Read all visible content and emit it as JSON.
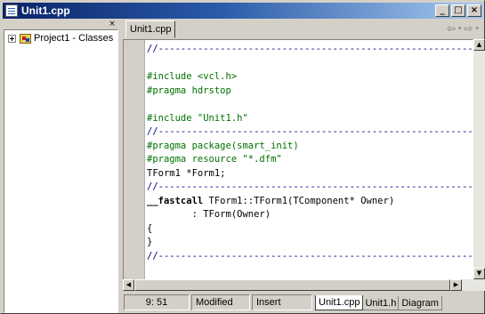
{
  "window": {
    "title": "Unit1.cpp"
  },
  "title_buttons": {
    "minimize": "_",
    "maximize": "□",
    "close": "×"
  },
  "class_explorer": {
    "close_glyph": "×",
    "tree": [
      {
        "label": "Project1 - Classes",
        "expander": "plus",
        "icon": "project-classes-icon"
      }
    ]
  },
  "editor": {
    "active_tab": "Unit1.cpp",
    "nav": {
      "back": "⇦",
      "forward": "⇨",
      "dropdown": "▾"
    },
    "code_lines": [
      {
        "text": "//---------------------------------------------------------------------------",
        "style": "navy"
      },
      {
        "text": "",
        "style": "black"
      },
      {
        "text": "#include <vcl.h>",
        "style": "green"
      },
      {
        "text": "#pragma hdrstop",
        "style": "green"
      },
      {
        "text": "",
        "style": "black"
      },
      {
        "text": "#include \"Unit1.h\"",
        "style": "green"
      },
      {
        "text": "//---------------------------------------------------------------------------",
        "style": "navy"
      },
      {
        "text": "#pragma package(smart_init)",
        "style": "green"
      },
      {
        "text": "#pragma resource \"*.dfm\"",
        "style": "green"
      },
      {
        "text": "TForm1 *Form1;",
        "style": "black"
      },
      {
        "text": "//---------------------------------------------------------------------------",
        "style": "navy"
      },
      {
        "text": "__fastcall TForm1::TForm1(TComponent* Owner)",
        "style": "fastcall"
      },
      {
        "text": "        : TForm(Owner)",
        "style": "black"
      },
      {
        "text": "{",
        "style": "black"
      },
      {
        "text": "}",
        "style": "black"
      },
      {
        "text": "//---------------------------------------------------------------------------",
        "style": "navy"
      }
    ]
  },
  "scrollbars": {
    "up": "▲",
    "down": "▼",
    "left": "◀",
    "right": "▶"
  },
  "status": {
    "position": "9:  51",
    "modified": "Modified",
    "mode": "Insert",
    "bottom_tabs": [
      "Unit1.cpp",
      "Unit1.h",
      "Diagram"
    ],
    "active_bottom_tab": 0
  },
  "colors": {
    "directive": "#007000",
    "comment": "#000080",
    "title_gradient_start": "#0a246a",
    "title_gradient_end": "#a6caf0",
    "chrome": "#d4d0c8"
  }
}
